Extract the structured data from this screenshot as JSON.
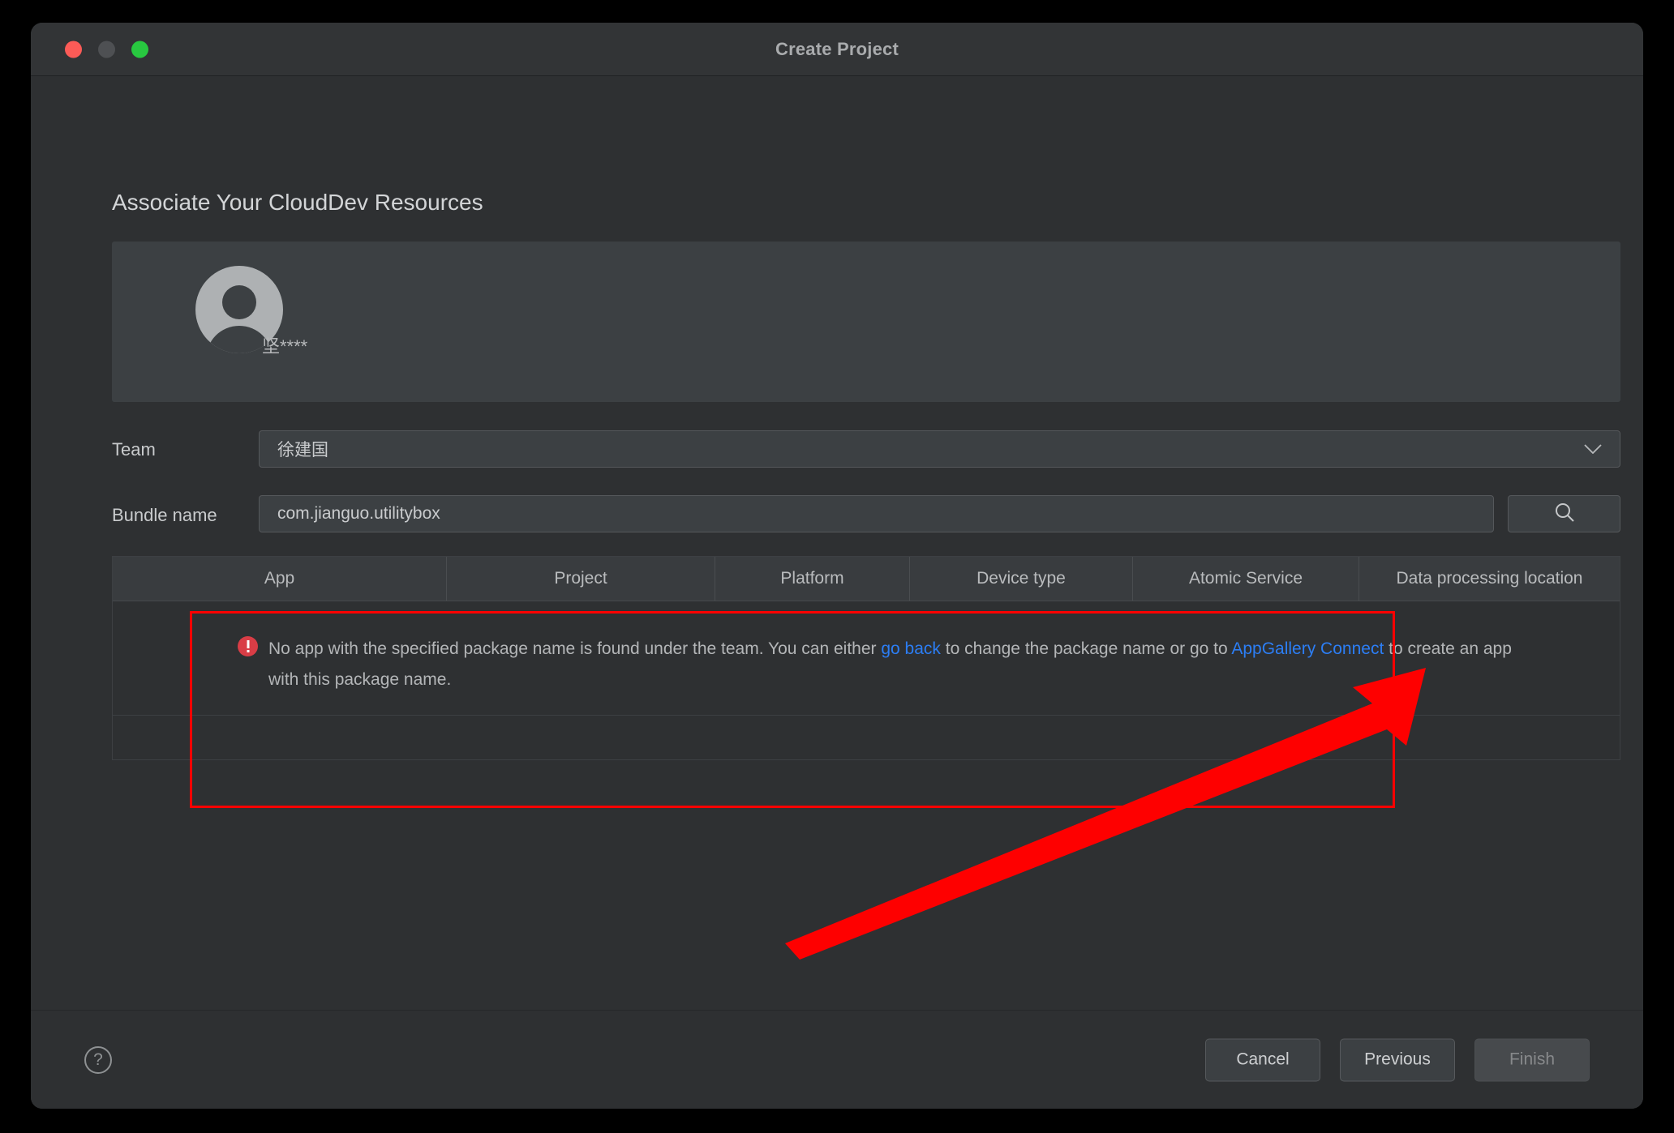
{
  "window": {
    "title": "Create Project",
    "traffic_lights": [
      "close",
      "minimize",
      "zoom"
    ]
  },
  "page": {
    "heading": "Associate Your CloudDev Resources"
  },
  "user": {
    "name": "坚****",
    "avatar_icon": "person-avatar-icon"
  },
  "form": {
    "team_label": "Team",
    "team_value": "徐建国",
    "team_chevron_icon": "chevron-down-icon",
    "bundle_label": "Bundle name",
    "bundle_value": "com.jianguo.utilitybox",
    "bundle_placeholder": "",
    "search_icon": "search-icon"
  },
  "table": {
    "columns": [
      "App",
      "Project",
      "Platform",
      "Device type",
      "Atomic Service",
      "Data processing location"
    ],
    "rows": []
  },
  "error": {
    "icon": "error-exclamation-icon",
    "text_part1": "No app with the specified package name is found under the team. You can either ",
    "link1": "go back",
    "text_part2": " to change the package name or go to ",
    "link2": "AppGallery Connect",
    "text_part3": " to create an app with this package name."
  },
  "footer": {
    "help_icon": "help-question-icon",
    "cancel_label": "Cancel",
    "previous_label": "Previous",
    "finish_label": "Finish"
  },
  "annotation": {
    "highlight_color": "#fe0000",
    "arrow_color": "#fe0000",
    "shape": "arrow-pointing-to-appgallery-connect-link"
  }
}
